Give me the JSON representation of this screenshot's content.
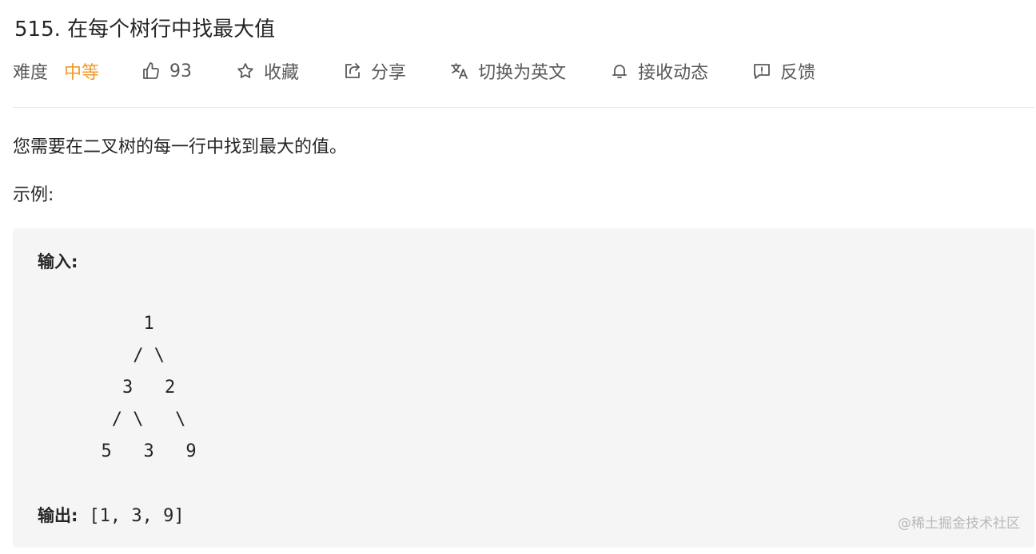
{
  "title": "515. 在每个树行中找最大值",
  "meta": {
    "difficulty_label": "难度",
    "difficulty_value": "中等",
    "like_count": "93",
    "favorite_label": "收藏",
    "share_label": "分享",
    "translate_label": "切换为英文",
    "subscribe_label": "接收动态",
    "feedback_label": "反馈",
    "icons": [
      "thumbs-up-icon",
      "star-icon",
      "share-icon",
      "translate-icon",
      "bell-icon",
      "feedback-icon"
    ],
    "difficulty_color": "#ef9a2b"
  },
  "description": "您需要在二叉树的每一行中找到最大的值。",
  "example_label": "示例:",
  "example": {
    "input_label": "输入:",
    "tree_lines": [
      "          1",
      "         / \\",
      "        3   2",
      "       / \\   \\",
      "      5   3   9"
    ],
    "output_label": "输出:",
    "output_value": "[1, 3, 9]"
  },
  "watermark": "@稀土掘金技术社区"
}
